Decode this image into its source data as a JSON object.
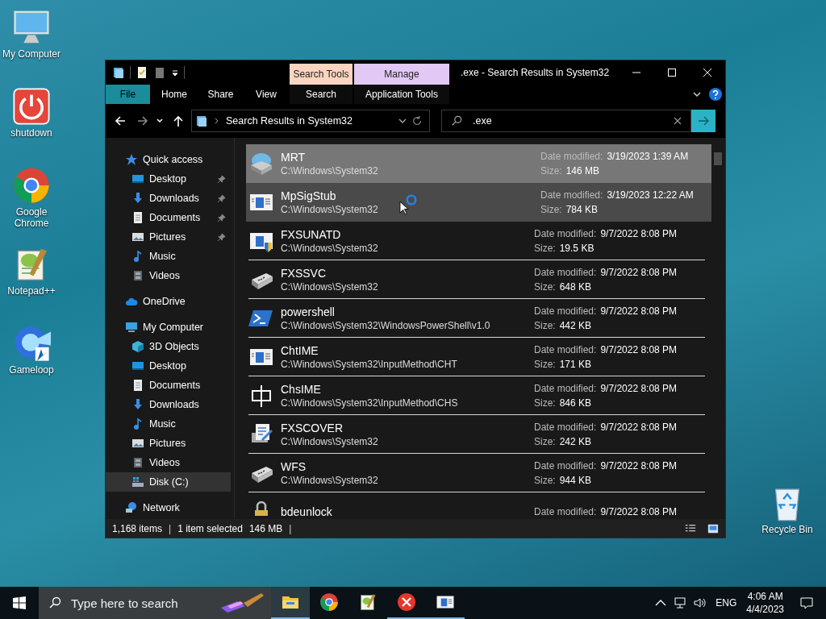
{
  "desktop_icons": [
    {
      "label": "My Computer",
      "kind": "computer"
    },
    {
      "label": "shutdown",
      "kind": "power"
    },
    {
      "label": "Google Chrome",
      "kind": "chrome"
    },
    {
      "label": "Notepad++",
      "kind": "notepad"
    },
    {
      "label": "Gameloop",
      "kind": "gameloop"
    }
  ],
  "recycle_bin": {
    "label": "Recycle Bin"
  },
  "window": {
    "title": ".exe - Search Results in System32",
    "contextual_tabs": [
      {
        "label": "Search Tools",
        "color": "#fbd5c0"
      },
      {
        "label": "Manage",
        "color": "#e2c8f4"
      }
    ],
    "ribbon_tabs": [
      {
        "label": "File",
        "kind": "file"
      },
      {
        "label": "Home",
        "kind": "tab"
      },
      {
        "label": "Share",
        "kind": "tab"
      },
      {
        "label": "View",
        "kind": "tab"
      },
      {
        "label": "Search",
        "kind": "contextual"
      },
      {
        "label": "Application Tools",
        "kind": "contextual"
      }
    ],
    "address": "Search Results in System32",
    "search_value": ".exe",
    "sidebar": [
      {
        "label": "Quick access",
        "kind": "star",
        "selected": false,
        "children": [
          {
            "label": "Desktop",
            "kind": "desktop",
            "pinned": true,
            "selected": false
          },
          {
            "label": "Downloads",
            "kind": "download",
            "pinned": true,
            "selected": false
          },
          {
            "label": "Documents",
            "kind": "document",
            "pinned": true,
            "selected": false
          },
          {
            "label": "Pictures",
            "kind": "picture",
            "pinned": true,
            "selected": false
          },
          {
            "label": "Music",
            "kind": "music",
            "pinned": false,
            "selected": false
          },
          {
            "label": "Videos",
            "kind": "video",
            "pinned": false,
            "selected": false
          }
        ]
      },
      {
        "label": "OneDrive",
        "kind": "cloud",
        "selected": false
      },
      {
        "label": "My Computer",
        "kind": "computer",
        "selected": false,
        "children": [
          {
            "label": "3D Objects",
            "kind": "cube",
            "pinned": false,
            "selected": false
          },
          {
            "label": "Desktop",
            "kind": "desktop",
            "pinned": false,
            "selected": false
          },
          {
            "label": "Documents",
            "kind": "document",
            "pinned": false,
            "selected": false
          },
          {
            "label": "Downloads",
            "kind": "download",
            "pinned": false,
            "selected": false
          },
          {
            "label": "Music",
            "kind": "music",
            "pinned": false,
            "selected": false
          },
          {
            "label": "Pictures",
            "kind": "picture",
            "pinned": false,
            "selected": false
          },
          {
            "label": "Videos",
            "kind": "video",
            "pinned": false,
            "selected": false
          },
          {
            "label": "Disk (C:)",
            "kind": "disk",
            "pinned": false,
            "selected": true
          }
        ]
      },
      {
        "label": "Network",
        "kind": "network",
        "selected": false
      }
    ],
    "results": [
      {
        "name": "MRT",
        "path": "C:\\Windows\\System32",
        "date_label": "Date modified:",
        "date": "3/19/2023 1:39 AM",
        "size_label": "Size:",
        "size": "146 MB",
        "kind": "mrt",
        "selected": true,
        "hovered": false
      },
      {
        "name": "MpSigStub",
        "path": "C:\\Windows\\System32",
        "date_label": "Date modified:",
        "date": "3/19/2023 12:22 AM",
        "size_label": "Size:",
        "size": "784 KB",
        "kind": "window",
        "selected": false,
        "hovered": true
      },
      {
        "name": "FXSUNATD",
        "path": "C:\\Windows\\System32",
        "date_label": "Date modified:",
        "date": "9/7/2022 8:08 PM",
        "size_label": "Size:",
        "size": "19.5 KB",
        "kind": "window-shield",
        "selected": false,
        "hovered": false
      },
      {
        "name": "FXSSVC",
        "path": "C:\\Windows\\System32",
        "date_label": "Date modified:",
        "date": "9/7/2022 8:08 PM",
        "size_label": "Size:",
        "size": "648 KB",
        "kind": "fax",
        "selected": false,
        "hovered": false
      },
      {
        "name": "powershell",
        "path": "C:\\Windows\\System32\\WindowsPowerShell\\v1.0",
        "date_label": "Date modified:",
        "date": "9/7/2022 8:08 PM",
        "size_label": "Size:",
        "size": "442 KB",
        "kind": "powershell",
        "selected": false,
        "hovered": false
      },
      {
        "name": "ChtIME",
        "path": "C:\\Windows\\System32\\InputMethod\\CHT",
        "date_label": "Date modified:",
        "date": "9/7/2022 8:08 PM",
        "size_label": "Size:",
        "size": "171 KB",
        "kind": "window",
        "selected": false,
        "hovered": false
      },
      {
        "name": "ChsIME",
        "path": "C:\\Windows\\System32\\InputMethod\\CHS",
        "date_label": "Date modified:",
        "date": "9/7/2022 8:08 PM",
        "size_label": "Size:",
        "size": "846 KB",
        "kind": "symbol",
        "selected": false,
        "hovered": false
      },
      {
        "name": "FXSCOVER",
        "path": "C:\\Windows\\System32",
        "date_label": "Date modified:",
        "date": "9/7/2022 8:08 PM",
        "size_label": "Size:",
        "size": "242 KB",
        "kind": "cover",
        "selected": false,
        "hovered": false
      },
      {
        "name": "WFS",
        "path": "C:\\Windows\\System32",
        "date_label": "Date modified:",
        "date": "9/7/2022 8:08 PM",
        "size_label": "Size:",
        "size": "944 KB",
        "kind": "fax",
        "selected": false,
        "hovered": false
      },
      {
        "name": "bdeunlock",
        "date_label": "Date modified:",
        "date": "9/7/2022 8:08 PM",
        "kind": "lock",
        "selected": false,
        "hovered": false
      }
    ],
    "status_bar": {
      "count": "1,168 items",
      "separator_1": "|",
      "selection": "1 item selected",
      "size": "146 MB",
      "separator_2": "|"
    }
  },
  "taskbar": {
    "search_placeholder": "Type here to search",
    "apps": [
      {
        "kind": "explorer",
        "running": true,
        "active": true
      },
      {
        "kind": "chrome",
        "running": false,
        "active": false
      },
      {
        "kind": "notepad",
        "running": false,
        "active": false
      },
      {
        "kind": "error",
        "running": true,
        "active": false
      },
      {
        "kind": "window",
        "running": true,
        "active": false
      }
    ],
    "language": "ENG",
    "time": "4:06 AM",
    "date": "4/4/2023"
  }
}
